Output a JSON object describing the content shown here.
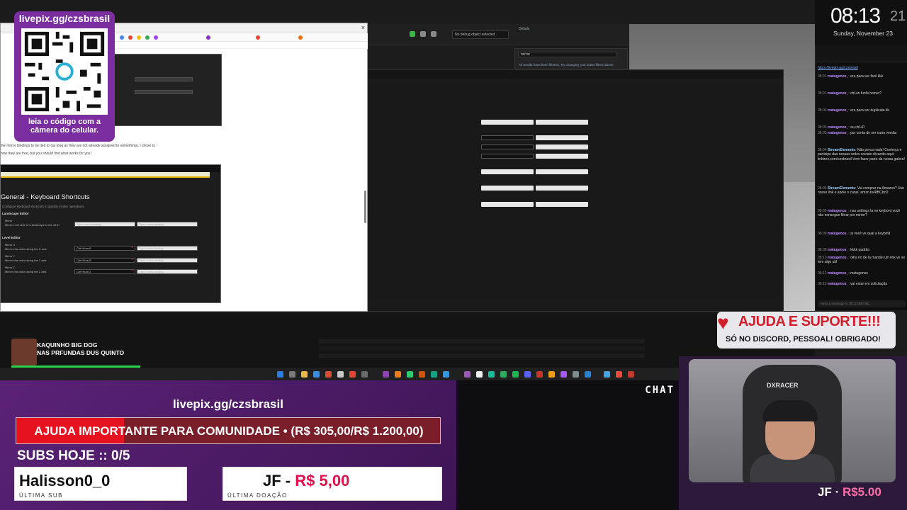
{
  "qr_overlay": {
    "url": "livepix.gg/czsbrasil",
    "caption": "leia o código com a câmera do celular."
  },
  "clock": {
    "time": "08:13",
    "seconds": "21",
    "date": "Sunday, November 23"
  },
  "browser": {
    "article_text": "the mirror bindings to be tied to (as long as they are not already assigned to something). I chose to",
    "article_text_2": "how they are free, but you should find what works for you!"
  },
  "shortcuts_shot": {
    "title": "General - Keyboard Shortcuts",
    "subtitle": "Configure keyboard shortcuts to quickly invoke operations.",
    "sections": [
      {
        "name": "Landscape Editor",
        "rows": [
          {
            "label": "Mirror",
            "desc": "Mirrors one side of a landscape to the other",
            "key1": "Type a new binding",
            "key2": "Type a new binding",
            "key1_set": false
          }
        ]
      },
      {
        "name": "Level Editor",
        "rows": [
          {
            "label": "Mirror X",
            "desc": "Mirrors the actor along the X axis",
            "key1": "Ctrl+Num 8",
            "key2": "Type a new binding",
            "key1_set": true
          },
          {
            "label": "Mirror Y",
            "desc": "Mirrors the actor along the Y axis",
            "key1": "Ctrl+Num 5",
            "key2": "Type a new binding",
            "key1_set": true
          },
          {
            "label": "Mirror Z",
            "desc": "Mirrors the actor along the Z axis",
            "key1": "Ctrl+Num 2",
            "key2": "Type a new binding",
            "key1_set": true
          }
        ]
      }
    ]
  },
  "editor": {
    "dropdown": "No debug object selected",
    "details_tab": "Details",
    "search_value": "mirror",
    "no_results": "All results have been filtered. Try changing your active filters above."
  },
  "chat": {
    "link": "https://livepix.gg/czsbrasil",
    "messages": [
      {
        "time": "08:01",
        "user": "matugenos_",
        "text": "era para ser facil kkk"
      },
      {
        "time": "08:01",
        "user": "matugenos_",
        "text": "ctrl+w funfa homer?"
      },
      {
        "time": "08:02",
        "user": "matugenos_",
        "text": "era para ser duplicata kk"
      },
      {
        "time": "08:03",
        "user": "matugenos_",
        "text": "ou ctrl+D"
      },
      {
        "time": "08:03",
        "user": "matugenos_",
        "text": "por conta de ser outra versão"
      },
      {
        "time": "08:04",
        "user": "StreamElements",
        "text": "Não perca nada! Conheça e participe das nossas redes sociais clicando aqui: linktree.com/czsbrasil Vem fazer parte da nossa galera!"
      },
      {
        "time": "08:04",
        "user": "StreamElements",
        "text": "Vai comprar na Amazon? Use nosso link e apoie o canal: amzn.to/4fBCbzD"
      },
      {
        "time": "08:06",
        "user": "matugenos_",
        "text": "nas settings la no keybord você não consegue filtrar por mirror?"
      },
      {
        "time": "08:09",
        "user": "matugenos_",
        "text": "ai você ve qual a keybind"
      },
      {
        "time": "08:09",
        "user": "matugenos_",
        "text": "kkkk padrão"
      },
      {
        "time": "08:10",
        "user": "matugenos_",
        "text": "olha no de la mandei um link ve se tem algo util"
      },
      {
        "time": "08:12",
        "user": "matugenos_",
        "text": "matugenos"
      },
      {
        "time": "08:13",
        "user": "matugenos_",
        "text": "vai estar em solicitação"
      }
    ],
    "send_placeholder": "Send a message to @CZSBRASIL"
  },
  "sub_alert": {
    "line1": "KAQUINHO BIG DOG",
    "line2": "NAS PRFUNDAS DUS QUINTO"
  },
  "help_badge": {
    "title": "AJUDA E SUPORTE!!!",
    "subtitle": "SÓ NO DISCORD, PESSOAL! OBRIGADO!"
  },
  "donation_overlay": {
    "url": "livepix.gg/czsbrasil",
    "goal_text": "AJUDA IMPORTANTE PARA COMUNIDADE • (R$ 305,00/R$ 1.200,00)",
    "goal_current": 305,
    "goal_target": 1200,
    "subs_today": "SUBS HOJE :: 0/5",
    "last_sub_name": "Halisson0_0",
    "last_sub_caption": "ÚLTIMA SUB",
    "last_donation_name": "JF",
    "last_donation_amount": "R$ 5,00",
    "last_donation_caption": "ÚLTIMA DOAÇÃO"
  },
  "chat_panel_label": "CHAT",
  "webcam": {
    "chair_brand": "DXRACER",
    "donor_name": "JF",
    "donor_amount": "R$5.00"
  },
  "colors": {
    "overlay_purple": "#5b2277",
    "goal_red": "#e6121f",
    "alert_red": "#d31f2c"
  }
}
